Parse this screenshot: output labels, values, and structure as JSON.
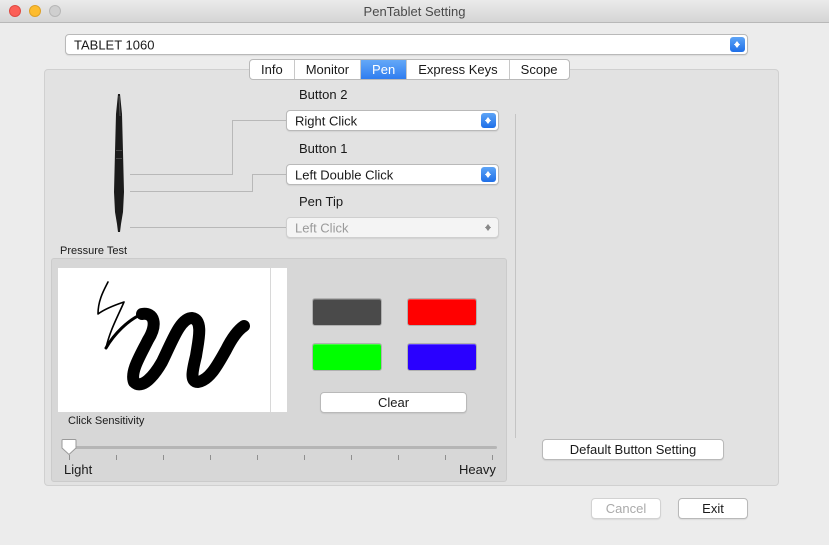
{
  "window": {
    "title": "PenTablet Setting"
  },
  "device_select": {
    "value": "TABLET 1060"
  },
  "tabs": [
    {
      "label": "Info"
    },
    {
      "label": "Monitor"
    },
    {
      "label": "Pen"
    },
    {
      "label": "Express Keys"
    },
    {
      "label": "Scope"
    }
  ],
  "active_tab": "Pen",
  "pen": {
    "button2": {
      "label": "Button 2",
      "value": "Right Click"
    },
    "button1": {
      "label": "Button 1",
      "value": "Left Double Click"
    },
    "pen_tip": {
      "label": "Pen Tip",
      "value": "Left Click",
      "enabled": false
    }
  },
  "pressure_test": {
    "label": "Pressure Test",
    "clear_label": "Clear",
    "colors": [
      {
        "name": "dark-gray",
        "hex": "#4a4a4a"
      },
      {
        "name": "red",
        "hex": "#ff0000"
      },
      {
        "name": "green",
        "hex": "#00ff00"
      },
      {
        "name": "blue",
        "hex": "#2a00ff"
      }
    ]
  },
  "click_sensitivity": {
    "label": "Click Sensitivity",
    "min_label": "Light",
    "max_label": "Heavy",
    "value_fraction": 0.0
  },
  "default_button": {
    "label": "Default Button Setting"
  },
  "footer": {
    "cancel_label": "Cancel",
    "exit_label": "Exit"
  }
}
